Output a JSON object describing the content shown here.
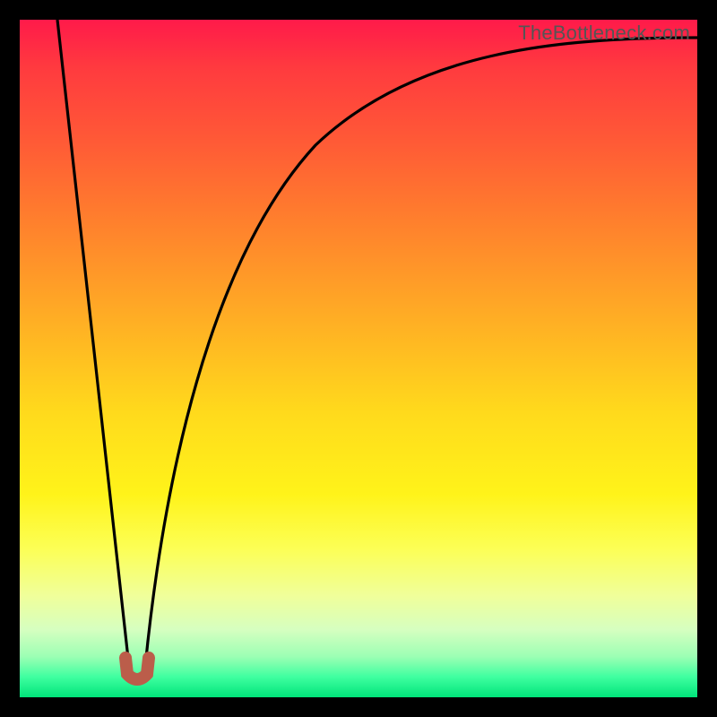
{
  "watermark": {
    "text": "TheBottleneck.com"
  },
  "colors": {
    "frame_border": "#000000",
    "curve_stroke": "#000000",
    "indicator_stroke": "#bb5d4a",
    "gradient_top": "#ff1a4a",
    "gradient_mid": "#ffda1c",
    "gradient_bottom": "#00e47a"
  },
  "chart_data": {
    "type": "line",
    "title": "",
    "xlabel": "",
    "ylabel": "",
    "x_range_percent": [
      0,
      100
    ],
    "y_range_percent": [
      0,
      100
    ],
    "optimal_x_percent": 17,
    "series": [
      {
        "name": "bottleneck-curve",
        "x_percent": [
          6,
          8,
          10,
          12,
          14,
          15,
          16,
          17,
          18,
          19,
          20,
          22,
          25,
          30,
          35,
          40,
          50,
          60,
          70,
          80,
          90,
          100
        ],
        "y_percent": [
          100,
          82,
          64,
          46,
          28,
          19,
          10,
          3,
          10,
          19,
          28,
          42,
          56,
          70,
          78,
          83,
          89,
          92,
          94,
          95.5,
          96.5,
          97.5
        ]
      }
    ],
    "indicator": {
      "name": "optimal-marker",
      "x_percent": 17,
      "y_percent": 3
    },
    "grid": false,
    "legend": false
  }
}
